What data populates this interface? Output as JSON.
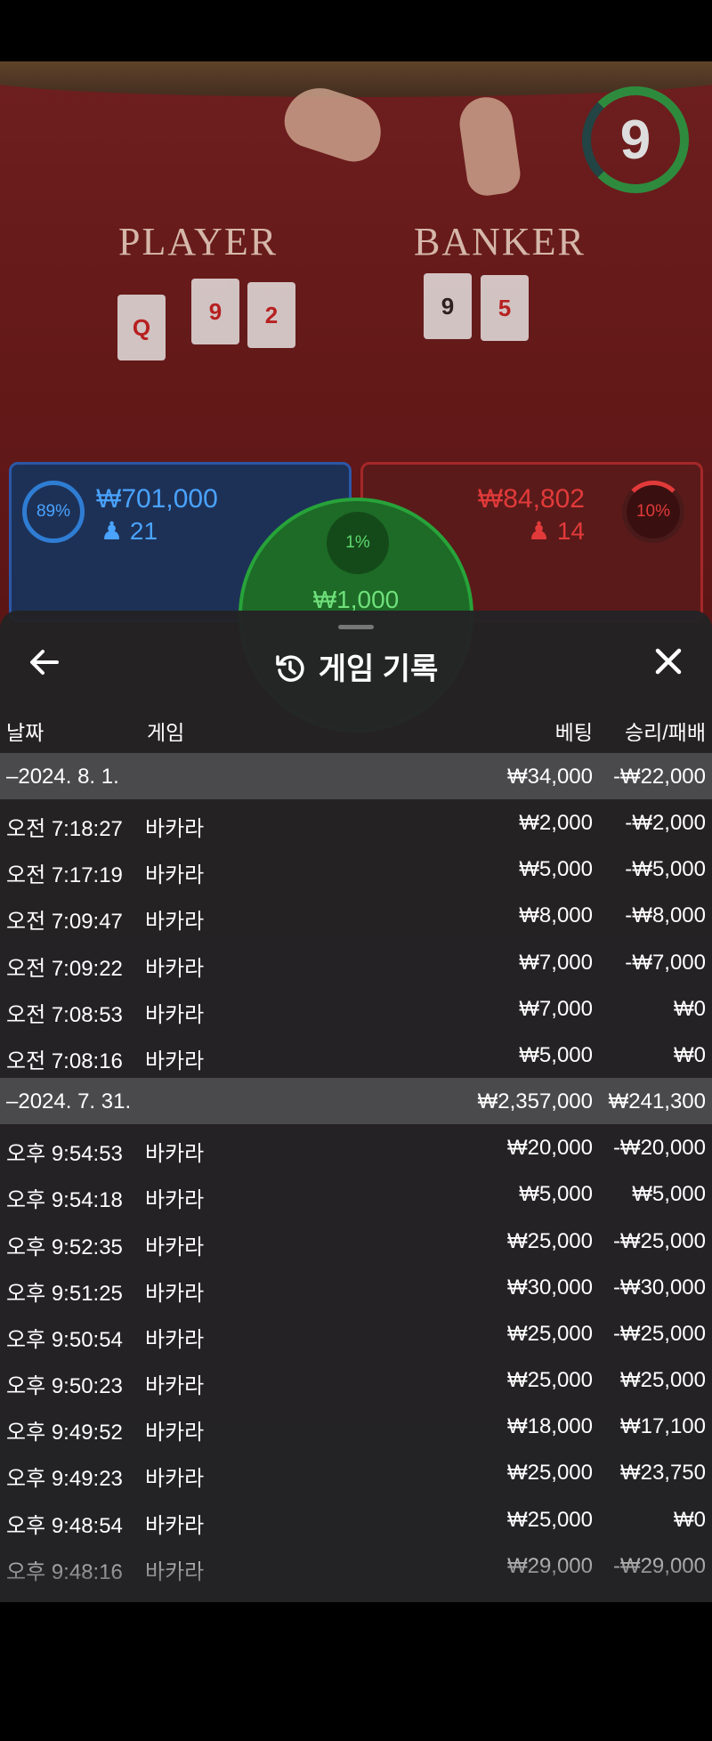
{
  "game": {
    "timer": "9",
    "player_label": "PLAYER",
    "banker_label": "BANKER",
    "player_cards": [
      "Q",
      "9",
      "2"
    ],
    "banker_cards": [
      "9",
      "5"
    ],
    "player_pct": "89%",
    "player_amount": "₩701,000",
    "player_count": "21",
    "banker_pct": "10%",
    "banker_amount": "₩84,802",
    "banker_count": "14",
    "tie_pct": "1%",
    "tie_amount": "₩1,000"
  },
  "sheet": {
    "title": "게임 기록",
    "history_icon": "history-icon",
    "back_icon": "arrow-left-icon",
    "close_icon": "close-icon"
  },
  "columns": {
    "date": "날짜",
    "game": "게임",
    "bet": "베팅",
    "result": "승리/패배"
  },
  "groups": [
    {
      "label": "–2024. 8. 1.",
      "bet": "₩34,000",
      "result": "-₩22,000",
      "rows": [
        {
          "time": "오전 7:18:27",
          "game": "바카라",
          "bet": "₩2,000",
          "result": "-₩2,000"
        },
        {
          "time": "오전 7:17:19",
          "game": "바카라",
          "bet": "₩5,000",
          "result": "-₩5,000"
        },
        {
          "time": "오전 7:09:47",
          "game": "바카라",
          "bet": "₩8,000",
          "result": "-₩8,000"
        },
        {
          "time": "오전 7:09:22",
          "game": "바카라",
          "bet": "₩7,000",
          "result": "-₩7,000"
        },
        {
          "time": "오전 7:08:53",
          "game": "바카라",
          "bet": "₩7,000",
          "result": "₩0"
        },
        {
          "time": "오전 7:08:16",
          "game": "바카라",
          "bet": "₩5,000",
          "result": "₩0"
        }
      ]
    },
    {
      "label": "–2024. 7. 31.",
      "bet": "₩2,357,000",
      "result": "₩241,300",
      "rows": [
        {
          "time": "오후 9:54:53",
          "game": "바카라",
          "bet": "₩20,000",
          "result": "-₩20,000"
        },
        {
          "time": "오후 9:54:18",
          "game": "바카라",
          "bet": "₩5,000",
          "result": "₩5,000"
        },
        {
          "time": "오후 9:52:35",
          "game": "바카라",
          "bet": "₩25,000",
          "result": "-₩25,000"
        },
        {
          "time": "오후 9:51:25",
          "game": "바카라",
          "bet": "₩30,000",
          "result": "-₩30,000"
        },
        {
          "time": "오후 9:50:54",
          "game": "바카라",
          "bet": "₩25,000",
          "result": "-₩25,000"
        },
        {
          "time": "오후 9:50:23",
          "game": "바카라",
          "bet": "₩25,000",
          "result": "₩25,000"
        },
        {
          "time": "오후 9:49:52",
          "game": "바카라",
          "bet": "₩18,000",
          "result": "₩17,100"
        },
        {
          "time": "오후 9:49:23",
          "game": "바카라",
          "bet": "₩25,000",
          "result": "₩23,750"
        },
        {
          "time": "오후 9:48:54",
          "game": "바카라",
          "bet": "₩25,000",
          "result": "₩0"
        },
        {
          "time": "오후 9:48:16",
          "game": "바카라",
          "bet": "₩29,000",
          "result": "-₩29,000"
        }
      ]
    }
  ]
}
